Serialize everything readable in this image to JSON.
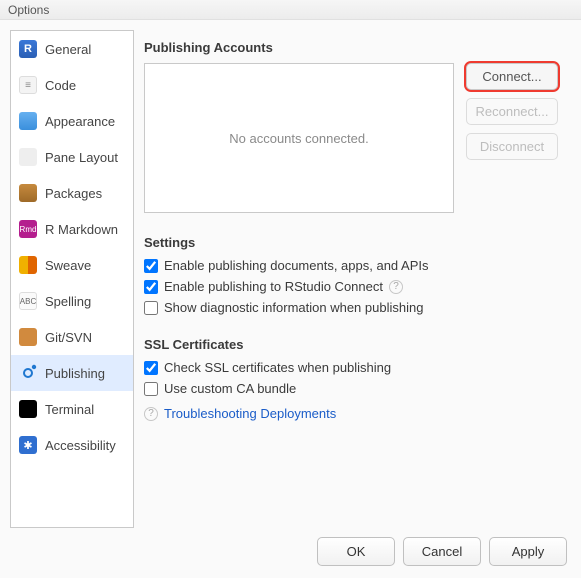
{
  "window": {
    "title": "Options"
  },
  "sidebar": {
    "items": [
      {
        "label": "General"
      },
      {
        "label": "Code"
      },
      {
        "label": "Appearance"
      },
      {
        "label": "Pane Layout"
      },
      {
        "label": "Packages"
      },
      {
        "label": "R Markdown"
      },
      {
        "label": "Sweave"
      },
      {
        "label": "Spelling"
      },
      {
        "label": "Git/SVN"
      },
      {
        "label": "Publishing"
      },
      {
        "label": "Terminal"
      },
      {
        "label": "Accessibility"
      }
    ],
    "selected_index": 9
  },
  "main": {
    "accounts": {
      "heading": "Publishing Accounts",
      "empty_text": "No accounts connected.",
      "buttons": {
        "connect": "Connect...",
        "reconnect": "Reconnect...",
        "disconnect": "Disconnect"
      }
    },
    "settings": {
      "heading": "Settings",
      "enable_publish_docs": {
        "label": "Enable publishing documents, apps, and APIs",
        "checked": true
      },
      "enable_publish_connect": {
        "label": "Enable publishing to RStudio Connect",
        "checked": true
      },
      "show_diag": {
        "label": "Show diagnostic information when publishing",
        "checked": false
      }
    },
    "ssl": {
      "heading": "SSL Certificates",
      "check_ssl": {
        "label": "Check SSL certificates when publishing",
        "checked": true
      },
      "custom_ca": {
        "label": "Use custom CA bundle",
        "checked": false
      }
    },
    "link": {
      "text": "Troubleshooting Deployments"
    }
  },
  "footer": {
    "ok": "OK",
    "cancel": "Cancel",
    "apply": "Apply"
  }
}
